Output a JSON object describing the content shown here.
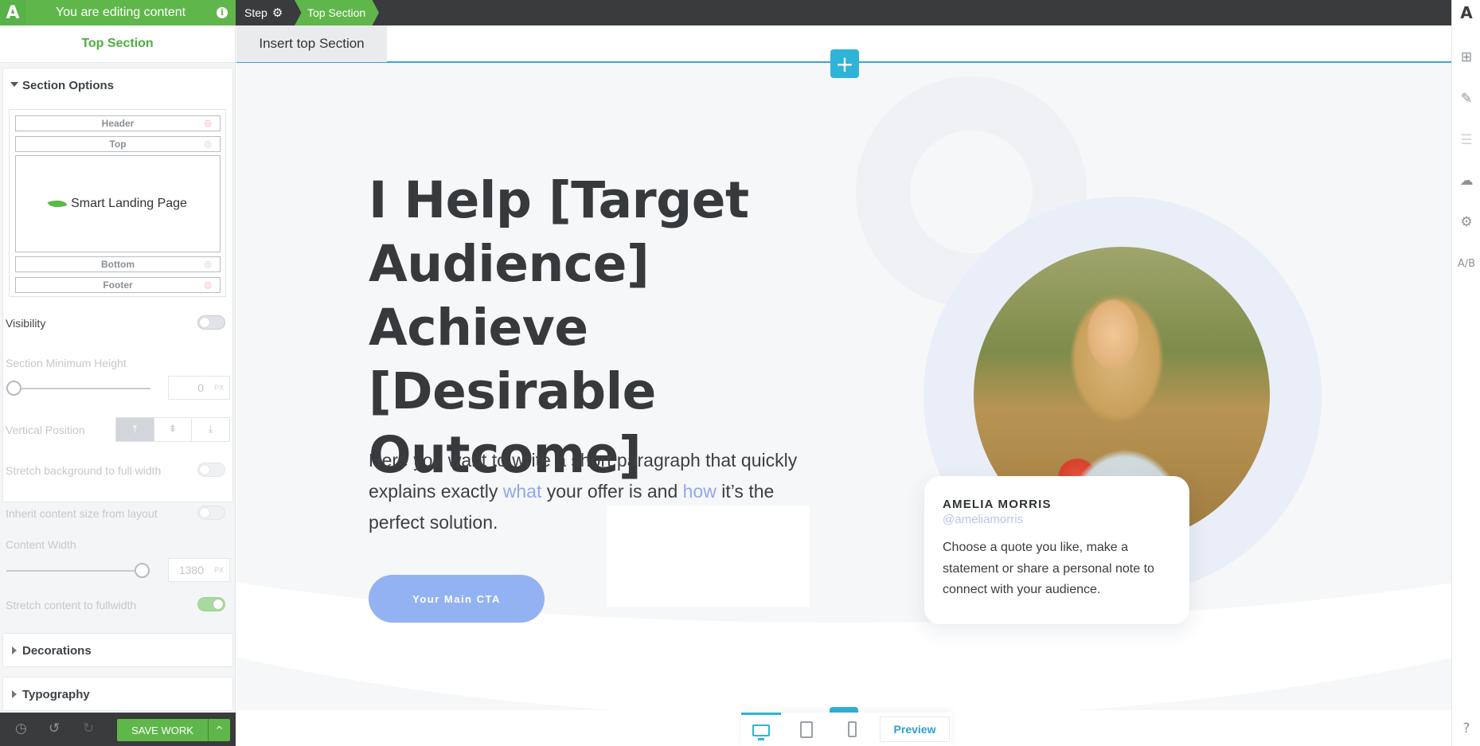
{
  "topbar": {
    "logo": "A",
    "editing_label": "You are editing content",
    "info_glyph": "i",
    "step_label": "Step",
    "crumb_section": "Top Section"
  },
  "left_panel": {
    "title": "Top Section",
    "section_options": {
      "heading": "Section Options",
      "layout_slots": {
        "header": "Header",
        "top": "Top",
        "top_content": "Smart Landing Page",
        "bottom": "Bottom",
        "footer": "Footer"
      },
      "visibility_label": "Visibility",
      "min_height_label": "Section Minimum Height",
      "min_height_value": "0",
      "unit": "PX",
      "vertical_position_label": "Vertical Position",
      "vertical_position_glyphs": [
        "⤒",
        "⇞",
        "⤓"
      ],
      "stretch_bg_label": "Stretch background to full width",
      "inherit_size_label": "Inherit content size from layout",
      "content_width_label": "Content Width",
      "content_width_value": "1380",
      "stretch_content_label": "Stretch content to fullwidth"
    },
    "decorations_heading": "Decorations",
    "typography_heading": "Typography"
  },
  "bottom_bar": {
    "save_label": "SAVE WORK",
    "more_glyph": "^"
  },
  "canvas": {
    "insert_label": "Insert top Section",
    "plus_glyph": "+",
    "headline": "I Help [Target Audience] Achieve [Desirable Outcome]",
    "sub_part1": "Here you want to write a short paragraph that quickly explains exactly ",
    "sub_hl1": "what",
    "sub_part2": " your offer is and ",
    "sub_hl2": "how",
    "sub_part3": " it’s the perfect solution.",
    "cta_label": "Your Main CTA",
    "quote": {
      "name": "AMELIA MORRIS",
      "handle": "@ameliamorris",
      "text": "Choose a quote you like, make a statement or share a personal note to connect with your audience."
    },
    "preview_label": "Preview"
  },
  "colors": {
    "brand_green": "#5fb64a",
    "accent_blue": "#2fb3d8",
    "cta_blue": "#93b2f2"
  }
}
